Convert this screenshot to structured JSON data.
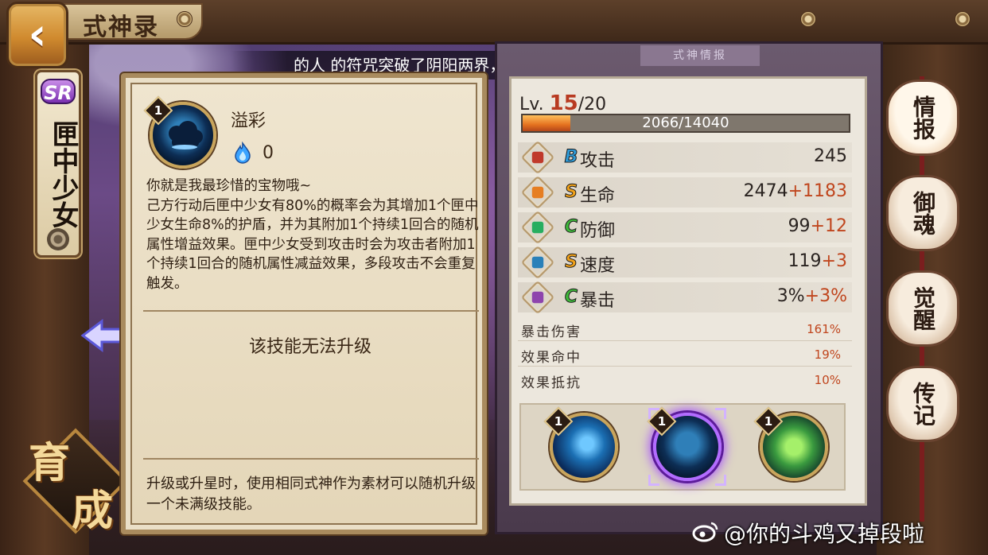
{
  "header": {
    "title": "式神录",
    "back_icon": "back-arrow-icon"
  },
  "announcement": "的人 的符咒突破了阴阳两界，召唤出了稀有 SR 式神 凤凰火！",
  "shikigami": {
    "rarity": "SR",
    "name": "匣中少女"
  },
  "grow_button": {
    "char1": "育",
    "char2": "成"
  },
  "skill_detail": {
    "level": "1",
    "name": "溢彩",
    "cost": "0",
    "quote": "你就是我最珍惜的宝物哦~",
    "description": "己方行动后匣中少女有80%的概率会为其增加1个匣中少女生命8%的护盾，并为其附加1个持续1回合的随机属性增益效果。匣中少女受到攻击时会为攻击者附加1个持续1回合的随机属性减益效果，多段攻击不会重复触发。",
    "upgrade_note": "该技能无法升级",
    "footer": "升级或升星时，使用相同式神作为素材可以随机升级一个未满级技能。"
  },
  "stats": {
    "header_tab": "式神情报",
    "level_prefix": "Lv.",
    "level_current": "15",
    "level_max": "/20",
    "exp_text": "2066/14040",
    "exp_fraction": 0.147,
    "rows": [
      {
        "rank": "B",
        "name": "攻击",
        "base": "245",
        "bonus": "",
        "icon": "attack-icon",
        "color": "#c0392b"
      },
      {
        "rank": "S",
        "name": "生命",
        "base": "2474",
        "bonus": "+1183",
        "icon": "health-icon",
        "color": "#e67e22"
      },
      {
        "rank": "C",
        "name": "防御",
        "base": "99",
        "bonus": "+12",
        "icon": "defense-icon",
        "color": "#27ae60"
      },
      {
        "rank": "S",
        "name": "速度",
        "base": "119",
        "bonus": "+3",
        "icon": "speed-icon",
        "color": "#2980b9"
      },
      {
        "rank": "C",
        "name": "暴击",
        "base": "3%",
        "bonus": "+3%",
        "icon": "crit-icon",
        "color": "#8e44ad"
      }
    ],
    "sub_stats": [
      {
        "name": "暴击伤害",
        "value": "161%"
      },
      {
        "name": "效果命中",
        "value": "19%"
      },
      {
        "name": "效果抵抗",
        "value": "10%"
      }
    ],
    "skills": [
      {
        "level": "1",
        "icon": "skill-1-icon"
      },
      {
        "level": "1",
        "icon": "skill-2-icon",
        "selected": true
      },
      {
        "level": "1",
        "icon": "skill-3-icon"
      }
    ]
  },
  "right_tabs": [
    {
      "label": "情报",
      "active": true
    },
    {
      "label": "御魂",
      "active": false
    },
    {
      "label": "觉醒",
      "active": false
    },
    {
      "label": "传记",
      "active": false
    }
  ],
  "watermark": "@你的斗鸡又掉段啦"
}
